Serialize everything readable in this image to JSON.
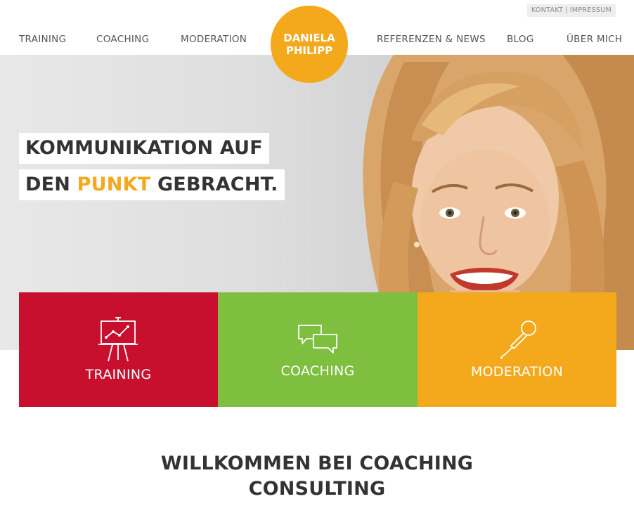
{
  "top_links": {
    "kontakt": "KONTAKT",
    "separator": "|",
    "impressum": "IMPRESSUM"
  },
  "nav": {
    "left": [
      "TRAINING",
      "COACHING",
      "MODERATION"
    ],
    "right": [
      "REFERENZEN & NEWS",
      "BLOG",
      "ÜBER MICH"
    ]
  },
  "logo": {
    "line1": "DANIELA",
    "line2": "PHILIPP",
    "color": "#f4a81b"
  },
  "hero": {
    "headline_line1": "KOMMUNIKATION AUF",
    "headline_line2_before": "DEN",
    "headline_line2_accent": "PUNKT",
    "headline_line2_after": "GEBRACHT.",
    "accent_color": "#f4a81b"
  },
  "tiles": [
    {
      "label": "TRAINING",
      "icon": "presentation-chart-icon",
      "color": "#c8102e"
    },
    {
      "label": "COACHING",
      "icon": "speech-bubbles-icon",
      "color": "#7fbf3f"
    },
    {
      "label": "MODERATION",
      "icon": "microphone-icon",
      "color": "#f4a81b"
    }
  ],
  "welcome": {
    "line1": "WILLKOMMEN BEI COACHING",
    "line2": "CONSULTING"
  }
}
